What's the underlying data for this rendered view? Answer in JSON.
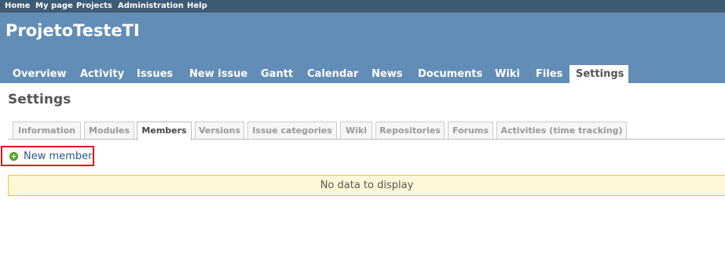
{
  "top_menu": {
    "items": [
      "Home",
      "My page",
      "Projects",
      "Administration",
      "Help"
    ]
  },
  "header": {
    "project_title": "ProjetoTesteTI"
  },
  "main_menu": {
    "items": [
      "Overview",
      "Activity",
      "Issues",
      "New issue",
      "Gantt",
      "Calendar",
      "News",
      "Documents",
      "Wiki",
      "Files",
      "Settings"
    ],
    "selected": "Settings"
  },
  "page": {
    "heading": "Settings"
  },
  "settings_tabs": {
    "items": [
      "Information",
      "Modules",
      "Members",
      "Versions",
      "Issue categories",
      "Wiki",
      "Repositories",
      "Forums",
      "Activities (time tracking)"
    ],
    "selected": "Members"
  },
  "members": {
    "new_member_label": "New member",
    "empty_message": "No data to display"
  },
  "colors": {
    "top_menu_bg": "#3e5b76",
    "header_bg": "#628db6",
    "highlight_border": "#e2151b",
    "nodata_bg": "#fff8d7",
    "nodata_border": "#f6c245",
    "link": "#2a5a8a"
  },
  "icons": {
    "new_member": "add-circle-icon"
  }
}
